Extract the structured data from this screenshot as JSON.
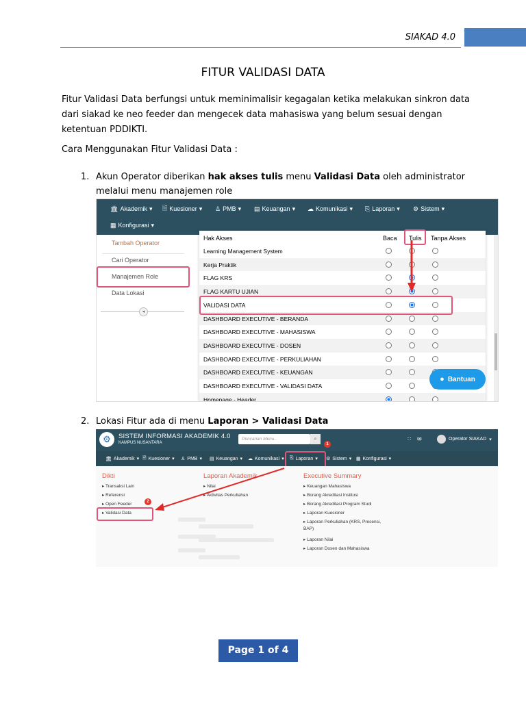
{
  "header": {
    "label": "SIAKAD 4.0",
    "accent": "#4a7fc2"
  },
  "title": "FITUR VALIDASI DATA",
  "intro": "Fitur Validasi Data berfungsi untuk meminimalisir kegagalan ketika melakukan sinkron data dari siakad ke neo feeder dan mengecek data mahasiswa yang belum sesuai dengan ketentuan PDDIKTI.",
  "how_to": "Cara Menggunakan Fitur Validasi Data :",
  "step1": {
    "num": "1.",
    "pre": "Akun Operator diberikan ",
    "bold1": "hak akses tulis",
    "mid": " menu ",
    "bold2": "Validasi Data",
    "post": " oleh administrator melalui menu manajemen role"
  },
  "step2": {
    "num": "2.",
    "pre": "Lokasi Fitur ada di menu ",
    "bold": "Laporan > Validasi Data"
  },
  "screen1": {
    "nav": [
      "Akademik",
      "Kuesioner",
      "PMB",
      "Keuangan",
      "Komunikasi",
      "Laporan",
      "Sistem",
      "Konfigurasi"
    ],
    "sidebar": [
      "Tambah Operator",
      "Cari Operator",
      "Manajemen Role",
      "Data Lokasi"
    ],
    "headers": {
      "akses": "Hak Akses",
      "baca": "Baca",
      "tulis": "Tulis",
      "tanpa": "Tanpa Akses"
    },
    "rows": [
      {
        "label": "Learning Management System",
        "selected": "none"
      },
      {
        "label": "Kerja Praktik",
        "selected": "none"
      },
      {
        "label": "FLAG KRS",
        "selected": "tulis"
      },
      {
        "label": "FLAG KARTU UJIAN",
        "selected": "tulis"
      },
      {
        "label": "VALIDASI DATA",
        "selected": "tulis"
      },
      {
        "label": "DASHBOARD EXECUTIVE - BERANDA",
        "selected": "none"
      },
      {
        "label": "DASHBOARD EXECUTIVE - MAHASISWA",
        "selected": "none"
      },
      {
        "label": "DASHBOARD EXECUTIVE - DOSEN",
        "selected": "none"
      },
      {
        "label": "DASHBOARD EXECUTIVE - PERKULIAHAN",
        "selected": "none"
      },
      {
        "label": "DASHBOARD EXECUTIVE - KEUANGAN",
        "selected": "none"
      },
      {
        "label": "DASHBOARD EXECUTIVE - VALIDASI DATA",
        "selected": "none"
      },
      {
        "label": "Homepage - Header",
        "selected": "baca"
      }
    ],
    "help_button": "Bantuan"
  },
  "screen2": {
    "app_title": "SISTEM INFORMASI AKADEMIK 4.0",
    "app_subtitle": "KAMPUS NUSANTARA",
    "search_placeholder": "Pencarian Menu..",
    "user": "Operator SIAKAD",
    "nav": [
      "Akademik",
      "Kuesioner",
      "PMB",
      "Keuangan",
      "Komunikasi",
      "Laporan",
      "Sistem",
      "Konfigurasi"
    ],
    "col1": {
      "title": "Dikti",
      "items": [
        "Transaksi Lain",
        "Referensi",
        "Open Feeder",
        "Validasi Data"
      ]
    },
    "col2": {
      "title": "Laporan Akademik",
      "items": [
        "Nilai",
        "Aktivitas Perkuliahan"
      ]
    },
    "col3": {
      "title": "Executive Summary",
      "items": [
        "Keuangan Mahasiswa",
        "Borang Akreditasi Institusi",
        "Borang Akreditasi Program Studi",
        "Laporan Kuesioner",
        "Laporan Perkuliahan (KRS, Presensi, BAP)",
        "Laporan Nilai",
        "Laporan Dosen dan Mahasiswa"
      ]
    },
    "badges": [
      "1",
      "2"
    ]
  },
  "footer": {
    "page": "Page 1 of 4"
  }
}
